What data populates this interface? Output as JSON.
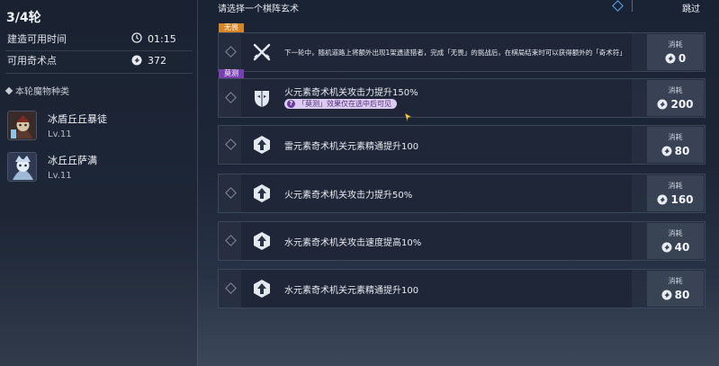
{
  "left_panel": {
    "round": "3/4轮",
    "build_time_label": "建造可用时间",
    "build_time_value": "01:15",
    "points_label": "可用奇术点",
    "points_value": "372",
    "monster_section_title": "本轮魔物种类",
    "monsters": [
      {
        "name": "冰盾丘丘暴徒",
        "level": "Lv.11"
      },
      {
        "name": "冰丘丘萨满",
        "level": "Lv.11"
      }
    ]
  },
  "header": {
    "title": "请选择一个棋阵玄术",
    "skip_label": "跳过"
  },
  "cards": [
    {
      "tag": "无畏",
      "tag_color": "#d78426",
      "icon": "crossed-swords-icon",
      "description": "下一轮中，随机道路上将额外出现1架遗迹猎者，完成「无畏」的挑战后，在棋局结束时可以获得额外的「奇术符」",
      "cost_label": "消耗",
      "cost_value": "0"
    },
    {
      "tag": "莫测",
      "tag_color": "#7a3fb1",
      "icon": "mask-icon",
      "description": "火元素奇术机关攻击力提升150%",
      "hint": "「莫测」效果仅在选中后可见",
      "cost_label": "消耗",
      "cost_value": "200"
    },
    {
      "icon": "upgrade-arrow-icon",
      "description": "雷元素奇术机关元素精通提升100",
      "cost_label": "消耗",
      "cost_value": "80"
    },
    {
      "icon": "upgrade-arrow-icon",
      "description": "火元素奇术机关攻击力提升50%",
      "cost_label": "消耗",
      "cost_value": "160"
    },
    {
      "icon": "upgrade-arrow-icon",
      "description": "水元素奇术机关攻击速度提高10%",
      "cost_label": "消耗",
      "cost_value": "40"
    },
    {
      "icon": "upgrade-arrow-icon",
      "description": "水元素奇术机关元素精通提升100",
      "cost_label": "消耗",
      "cost_value": "80"
    }
  ]
}
